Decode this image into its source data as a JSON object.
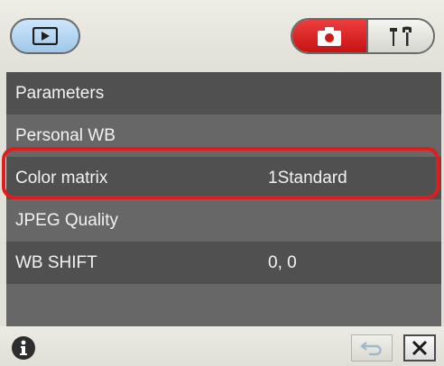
{
  "toolbar": {
    "playback_icon": "playback-icon",
    "camera_icon": "camera-icon",
    "setup_icon": "tools-icon",
    "active_mode_color": "#d92020"
  },
  "menu": {
    "items": [
      {
        "label": "Parameters",
        "value": ""
      },
      {
        "label": "Personal WB",
        "value": ""
      },
      {
        "label": "Color matrix",
        "value": "1Standard",
        "selected": true
      },
      {
        "label": "JPEG Quality",
        "value": ""
      },
      {
        "label": "WB SHIFT",
        "value": "0, 0"
      },
      {
        "label": "",
        "value": ""
      }
    ],
    "selection_color": "#e01c1c"
  },
  "bottom": {
    "info_icon": "info-icon",
    "back_icon": "back-icon",
    "back_enabled": false,
    "close_icon": "close-icon"
  }
}
